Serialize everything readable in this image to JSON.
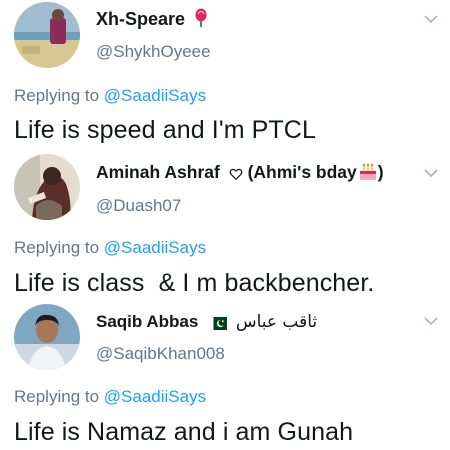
{
  "tweets": [
    {
      "name": "Xh-Speare",
      "name_icon": "balloon-icon",
      "handle": "@ShykhOyeee",
      "reply_prefix": "Replying to",
      "reply_to": "@SaadiiSays",
      "text": "Life is speed and I'm PTCL"
    },
    {
      "name": "Aminah Ashraf",
      "name_icon": "heart-outline-icon",
      "name_suffix": "(Ahmi's bday",
      "name_suffix_icon": "birthday-cake-icon",
      "name_close": ")",
      "handle": "@Duash07",
      "reply_prefix": "Replying to",
      "reply_to": "@SaadiiSays",
      "text": "Life is class  & I m backbencher."
    },
    {
      "name": "Saqib Abbas",
      "name_icon": "pakistan-flag-icon",
      "name_urdu": "ثاقب عباس",
      "handle": "@SaqibKhan008",
      "reply_prefix": "Replying to",
      "reply_to": "@SaadiiSays",
      "text": "Life is Namaz and i am Gunah"
    }
  ],
  "colors": {
    "name": "#14171a",
    "secondary": "#657786",
    "link": "#1da1f2",
    "flag_green": "#01411c"
  }
}
